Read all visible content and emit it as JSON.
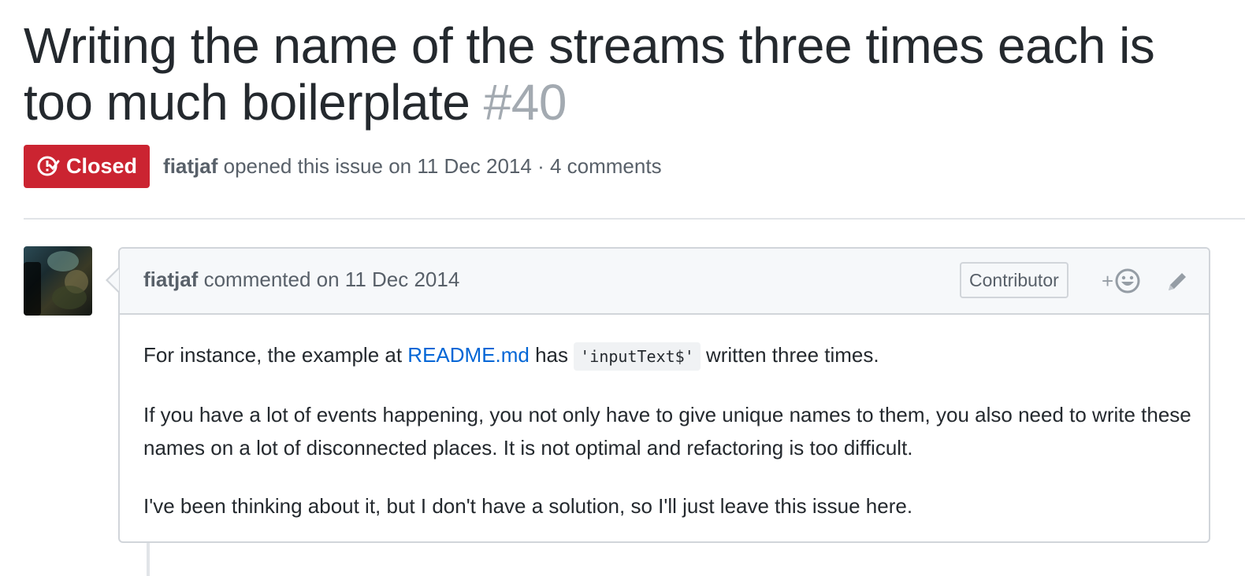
{
  "issue": {
    "title": "Writing the name of the streams three times each is too much boilerplate",
    "number": "#40",
    "state": "Closed",
    "author": "fiatjaf",
    "opened_text": "opened this issue on 11 Dec 2014 · 4 comments"
  },
  "comment": {
    "author": "fiatjaf",
    "meta": "commented on 11 Dec 2014",
    "role": "Contributor",
    "reaction_plus": "+",
    "body": {
      "p1_before": "For instance, the example at ",
      "p1_link": "README.md",
      "p1_mid": " has ",
      "p1_code": "'inputText$'",
      "p1_after": " written three times.",
      "p2": "If you have a lot of events happening, you not only have to give unique names to them, you also need to write these names on a lot of disconnected places. It is not optimal and refactoring is too difficult.",
      "p3": "I've been thinking about it, but I don't have a solution, so I'll just leave this issue here."
    }
  },
  "icons": {
    "state": "issue-closed-icon",
    "reaction": "smiley-icon",
    "edit": "pencil-icon"
  },
  "colors": {
    "closed_badge": "#cb2431",
    "link": "#0366d6",
    "muted": "#586069",
    "border": "#d1d5da",
    "header_bg": "#f6f8fa"
  }
}
